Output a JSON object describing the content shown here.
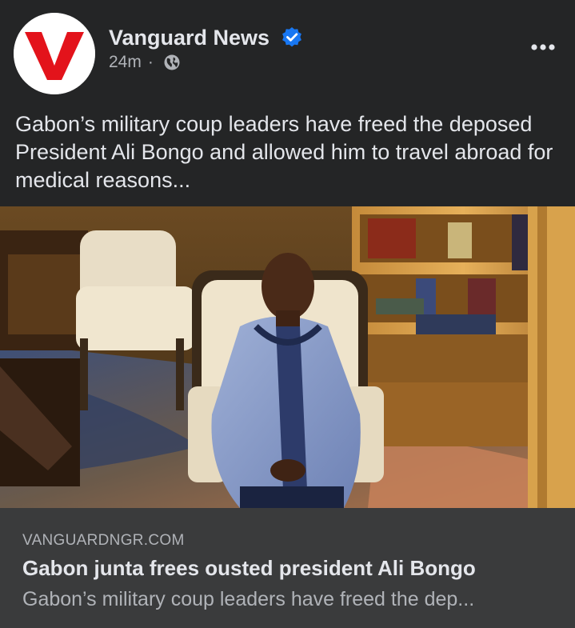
{
  "post": {
    "page_name": "Vanguard News",
    "time_ago": "24m",
    "separator": "·",
    "audience_icon": "globe-icon",
    "verified_icon": "verified-badge-icon",
    "more_icon": "more-options-icon",
    "caption": "Gabon’s military coup leaders have freed the deposed President Ali Bongo and allowed him to travel abroad for medical reasons...",
    "avatar_letter": "V"
  },
  "link_preview": {
    "domain": "VANGUARDNGR.COM",
    "title": "Gabon junta frees ousted president Ali Bongo",
    "description": "Gabon’s military coup leaders have freed the dep..."
  },
  "colors": {
    "background": "#242526",
    "card": "#3a3b3c",
    "primary_text": "#e4e6eb",
    "secondary_text": "#b0b3b8",
    "verified_blue": "#1877f2",
    "brand_red": "#e3131b"
  }
}
